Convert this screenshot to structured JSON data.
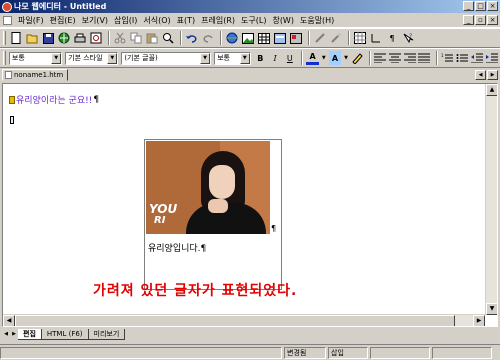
{
  "window": {
    "title": "나모 웹에디터 - Untitled",
    "controls": [
      "_",
      "□",
      "×"
    ],
    "mdi_controls": [
      "_",
      "▫",
      "×"
    ]
  },
  "menu": [
    "파일(F)",
    "편집(E)",
    "보기(V)",
    "삽입(I)",
    "서식(O)",
    "표(T)",
    "프레임(R)",
    "도구(L)",
    "창(W)",
    "도움말(H)"
  ],
  "toolbar1_icons": [
    "new-icon",
    "open-icon",
    "save-icon",
    "publish-icon",
    "print-icon",
    "preview-icon",
    "cut-icon",
    "copy-icon",
    "paste-icon",
    "find-icon",
    "undo-icon",
    "redo-icon",
    "link-icon",
    "image-icon",
    "table-icon",
    "form-icon",
    "plugin-icon",
    "layer-icon",
    "grid-icon",
    "ruler-icon",
    "paragraph-icon",
    "help-icon"
  ],
  "toolbar2": {
    "paragraph_style": "보통",
    "base_style": "기본 스타일",
    "font": "(기본 글꼴)",
    "font_size": "보통",
    "bold": "B",
    "italic": "I",
    "underline": "U",
    "font_color_label": "A",
    "text_bg_label": "A"
  },
  "tabs": {
    "document": "noname1.htm",
    "nav": [
      "◀",
      "▶"
    ]
  },
  "document": {
    "line1": "유리양이라는 군요!!",
    "para_mark": "¶",
    "photo_logo1": "YOU",
    "photo_logo2": "RI",
    "caption": "유리양입니다.¶",
    "red_note": "가려져 있던 글자가 표현되었다."
  },
  "view_tabs": [
    "편집",
    "HTML (F6)",
    "미리보기"
  ],
  "status": {
    "changed": "변경됨",
    "mode": "삽입"
  },
  "colors": {
    "title_gradient_start": "#0a246a",
    "title_gradient_end": "#a6caf0",
    "red_note": "#e00000",
    "line1_text": "#6b2bd4"
  }
}
